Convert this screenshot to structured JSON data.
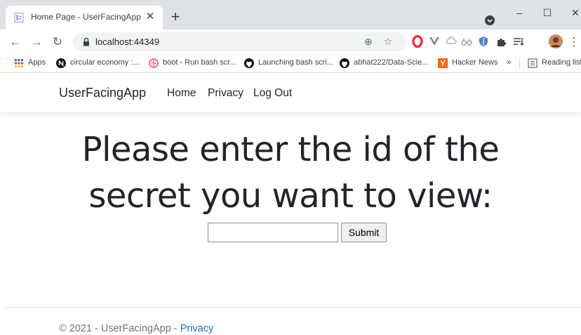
{
  "browser": {
    "tab_title": "Home Page - UserFacingApp",
    "url": "localhost:44349",
    "window_controls": {
      "minimize": "–",
      "maximize": "☐",
      "close": "✕"
    },
    "bookmarks": [
      {
        "label": "Apps",
        "icon": "apps-grid-icon"
      },
      {
        "label": "circular economy :...",
        "icon": "notion-icon"
      },
      {
        "label": "boot - Run bash scr...",
        "icon": "brain-icon"
      },
      {
        "label": "Launching bash scri...",
        "icon": "github-icon"
      },
      {
        "label": "abhat222/Data-Scie...",
        "icon": "github-icon"
      },
      {
        "label": "Hacker News",
        "icon": "hacker-news-icon"
      }
    ],
    "bookmarks_overflow": "»",
    "reading_list": "Reading list",
    "colors": {
      "tabstrip": "#dee1e6",
      "omnibox": "#f1f3f4",
      "hacker_news": "#ff6600",
      "opera": "#ff1b2d"
    }
  },
  "navbar": {
    "brand": "UserFacingApp",
    "links": [
      "Home",
      "Privacy",
      "Log Out"
    ]
  },
  "main": {
    "heading_line1": "Please enter the id of the",
    "heading_line2": "secret you want to view:",
    "input_value": "",
    "submit_label": "Submit"
  },
  "footer": {
    "text": "© 2021 - UserFacingApp - ",
    "privacy_link": "Privacy",
    "link_color": "#1b6ec2"
  }
}
